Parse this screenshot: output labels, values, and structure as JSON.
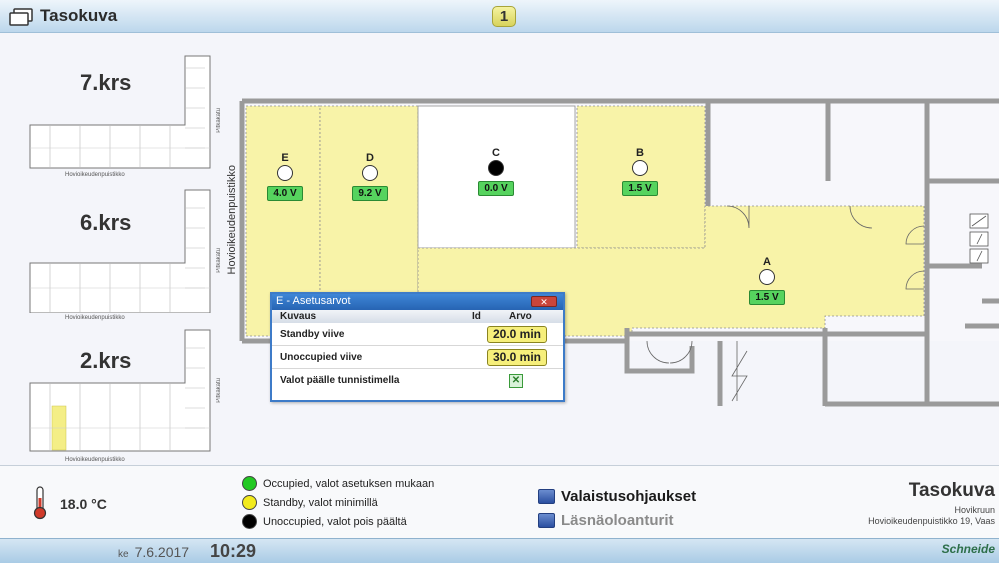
{
  "header": {
    "title": "Tasokuva",
    "page_number": "1"
  },
  "floors": [
    {
      "label": "7.krs",
      "street_bottom": "Hovioikeudenpuistikko",
      "street_side": "Pitkäkatu"
    },
    {
      "label": "6.krs",
      "street_bottom": "Hovioikeudenpuistikko",
      "street_side": "Pitkäkatu"
    },
    {
      "label": "2.krs",
      "street_bottom": "Hovioikeudenpuistikko",
      "street_side": "Pitkäkatu"
    }
  ],
  "plan": {
    "street_left": "Hovioikeudenpuistikko",
    "zones": [
      {
        "id": "E",
        "voltage": "4.0 V",
        "state": "standby"
      },
      {
        "id": "D",
        "voltage": "9.2 V",
        "state": "standby"
      },
      {
        "id": "C",
        "voltage": "0.0 V",
        "state": "unoccupied"
      },
      {
        "id": "B",
        "voltage": "1.5 V",
        "state": "standby"
      },
      {
        "id": "A",
        "voltage": "1.5 V",
        "state": "standby"
      }
    ]
  },
  "dialog": {
    "title": "E - Asetusarvot",
    "columns": {
      "kuvaus": "Kuvaus",
      "id": "Id",
      "arvo": "Arvo"
    },
    "rows": [
      {
        "label": "Standby viive",
        "value": "20.0 min"
      },
      {
        "label": "Unoccupied viive",
        "value": "30.0 min"
      },
      {
        "label": "Valot päälle tunnistimella",
        "checked": true
      }
    ]
  },
  "footer": {
    "temperature": "18.0 °C",
    "legend": [
      {
        "text": "Occupied, valot asetuksen mukaan",
        "color": "#22c922"
      },
      {
        "text": "Standby, valot minimillä",
        "color": "#f2ea1c"
      },
      {
        "text": "Unoccupied, valot pois päältä",
        "color": "#000000"
      }
    ],
    "nav": [
      {
        "label": "Valaistusohjaukset",
        "active": true
      },
      {
        "label": "Läsnäoloanturit",
        "active": false
      }
    ],
    "brand_title": "Tasokuva",
    "brand_line1": "Hovikruun",
    "brand_line2": "Hovioikeudenpuistikko 19, Vaas"
  },
  "status": {
    "weekday": "ke",
    "date": "7.6.2017",
    "time": "10:29",
    "logo": "Schneide"
  },
  "colors": {
    "zone_fill": "#f8f3a8",
    "wall": "#9a9a9a",
    "dialog_title": "#2f6fc0"
  }
}
